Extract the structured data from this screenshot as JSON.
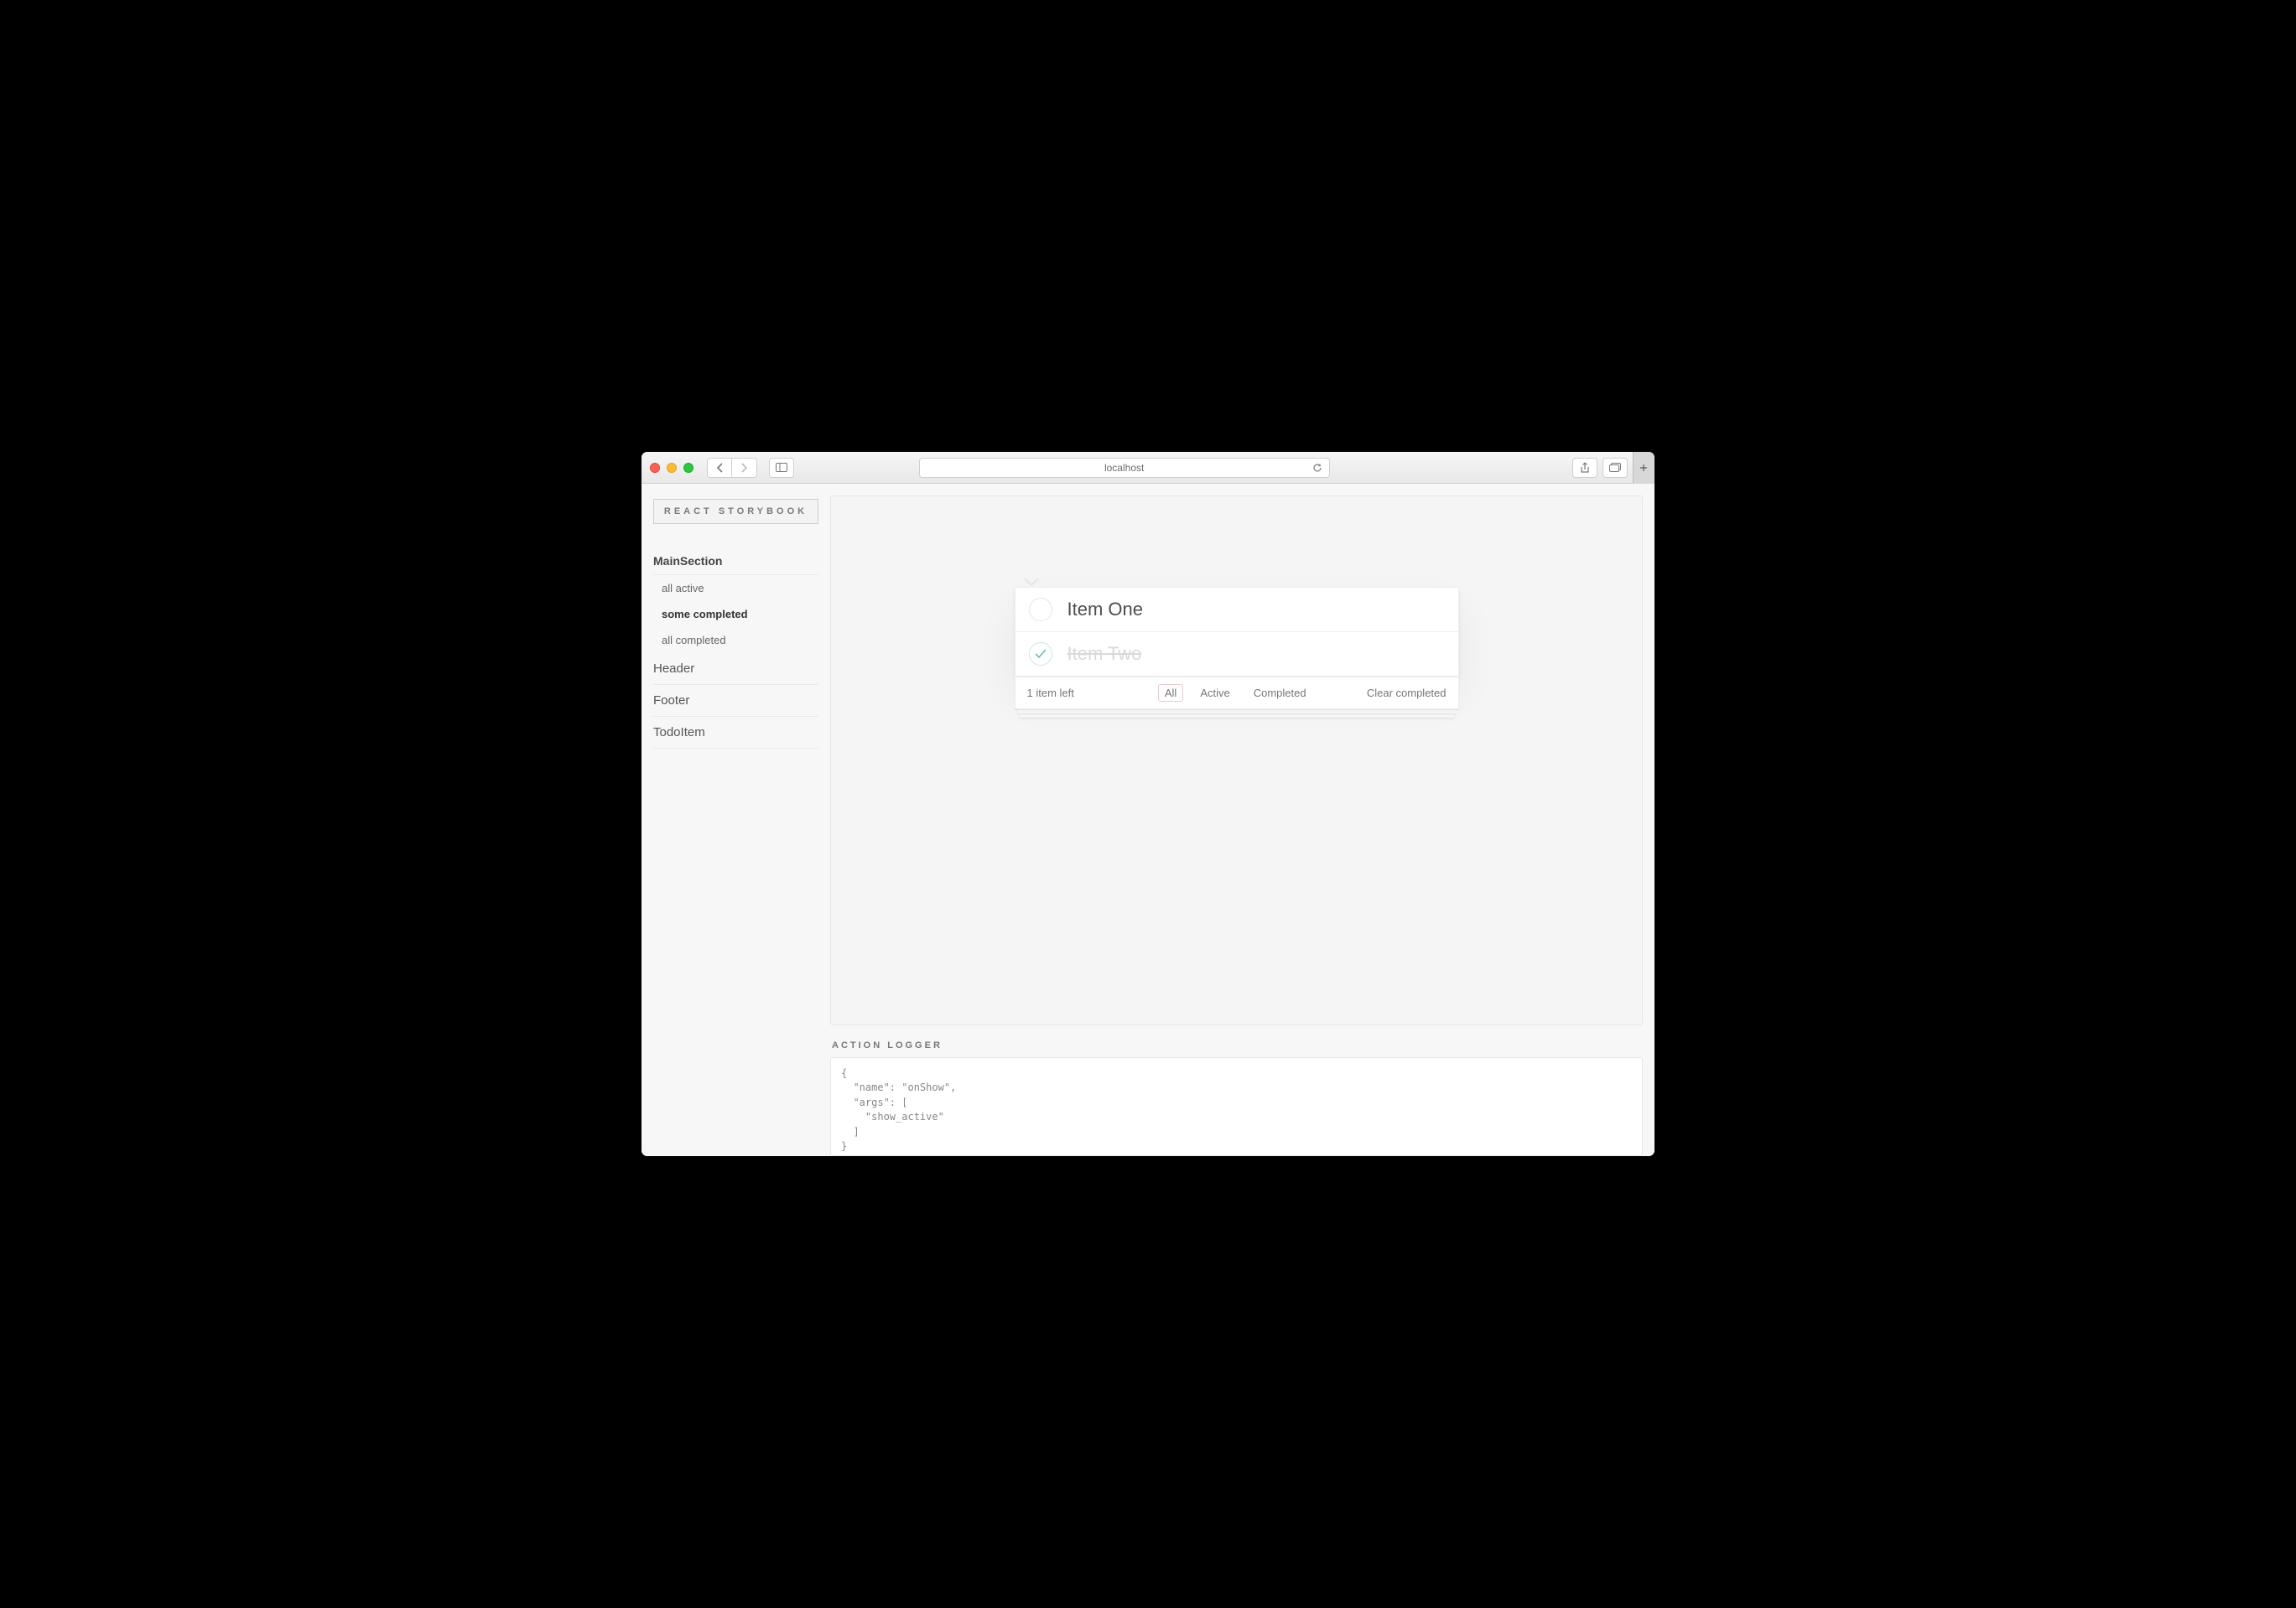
{
  "browser": {
    "url": "localhost"
  },
  "sidebar": {
    "brand": "REACT STORYBOOK",
    "kind": "MainSection",
    "stories": [
      "all active",
      "some completed",
      "all completed"
    ],
    "selected_story_index": 1,
    "other_kinds": [
      "Header",
      "Footer",
      "TodoItem"
    ]
  },
  "todo": {
    "items": [
      {
        "label": "Item One",
        "completed": false
      },
      {
        "label": "Item Two",
        "completed": true
      }
    ],
    "count_text": "1 item left",
    "filters": [
      "All",
      "Active",
      "Completed"
    ],
    "selected_filter_index": 0,
    "clear_label": "Clear completed"
  },
  "logger": {
    "title": "ACTION LOGGER",
    "body": "{\n  \"name\": \"onShow\",\n  \"args\": [\n    \"show_active\"\n  ]\n}\n\n{"
  }
}
